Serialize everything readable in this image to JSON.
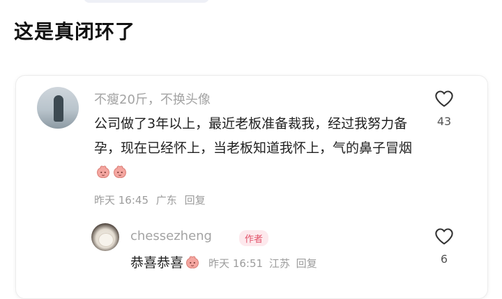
{
  "post": {
    "title": "这是真闭环了"
  },
  "comment": {
    "username": "不瘦20斤，不换头像",
    "text": "公司做了3年以上，最近老板准备裁我，经过我努力备孕，现在已经怀上，当老板知道我怀上，气的鼻子冒烟",
    "emoji_icon": "peach-emoji-icon",
    "time": "昨天 16:45",
    "location": "广东",
    "reply_label": "回复",
    "like_count": "43"
  },
  "reply": {
    "username": "chessezheng",
    "badge": "作者",
    "text": "恭喜恭喜",
    "emoji_icon": "peach-emoji-icon",
    "time": "昨天 16:51",
    "location": "江苏",
    "reply_label": "回复",
    "like_count": "6"
  },
  "colors": {
    "badge_text": "#e2526a",
    "badge_bg": "#fde9ed",
    "meta_text": "#9c9c9c"
  }
}
